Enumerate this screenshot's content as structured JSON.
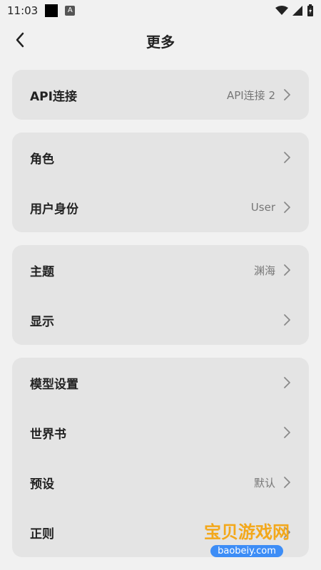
{
  "status_bar": {
    "time": "11:03",
    "a_badge": "A"
  },
  "header": {
    "title": "更多"
  },
  "groups": [
    {
      "items": [
        {
          "label": "API连接",
          "value": "API连接 2"
        }
      ]
    },
    {
      "items": [
        {
          "label": "角色",
          "value": ""
        },
        {
          "label": "用户身份",
          "value": "User"
        }
      ]
    },
    {
      "items": [
        {
          "label": "主题",
          "value": "渊海"
        },
        {
          "label": "显示",
          "value": ""
        }
      ]
    },
    {
      "items": [
        {
          "label": "模型设置",
          "value": ""
        },
        {
          "label": "世界书",
          "value": ""
        },
        {
          "label": "预设",
          "value": "默认"
        },
        {
          "label": "正则",
          "value": ""
        }
      ]
    }
  ],
  "watermark": {
    "title": "宝贝游戏网",
    "subtitle": "baobeiy.com"
  }
}
